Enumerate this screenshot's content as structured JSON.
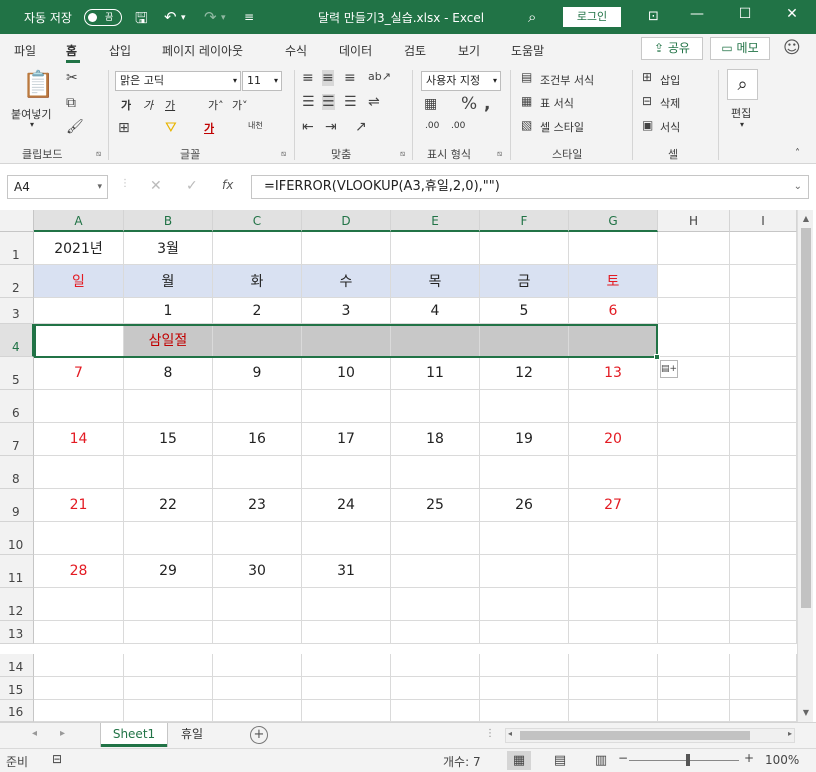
{
  "titlebar": {
    "autosave_label": "자동 저장",
    "autosave_state": "끔",
    "title": "달력 만들기3_실습.xlsx  -  Excel",
    "login": "로그인",
    "minimize": "—",
    "maximize": "☐",
    "close": "✕"
  },
  "tabs": [
    "파일",
    "홈",
    "삽입",
    "페이지 레이아웃",
    "수식",
    "데이터",
    "검토",
    "보기",
    "도움말"
  ],
  "share_label": "공유",
  "memo_label": "메모",
  "ribbon": {
    "paste": "붙여넣기",
    "clipboard": "클립보드",
    "font_name": "맑은 고딕",
    "font_size": "11",
    "font_group": "글꼴",
    "align_group": "맞춤",
    "number_format": "사용자 지정",
    "number_group": "표시 형식",
    "cond_format": "조건부 서식",
    "table_format": "표 서식",
    "cell_style": "셀 스타일",
    "style_group": "스타일",
    "insert": "삽입",
    "delete": "삭제",
    "format": "서식",
    "cells_group": "셀",
    "edit": "편집"
  },
  "formula_bar": {
    "name_box": "A4",
    "fx": "fx",
    "formula": "=IFERROR(VLOOKUP(A3,휴일,2,0),\"\")"
  },
  "columns": [
    "A",
    "B",
    "C",
    "D",
    "E",
    "F",
    "G",
    "H",
    "I"
  ],
  "rows": [
    "1",
    "2",
    "3",
    "4",
    "5",
    "6",
    "7",
    "8",
    "9",
    "10",
    "11",
    "12",
    "13",
    "14",
    "15",
    "16"
  ],
  "cells": {
    "r1": [
      "2021년",
      "3월",
      "",
      "",
      "",
      "",
      ""
    ],
    "r2": [
      "일",
      "월",
      "화",
      "수",
      "목",
      "금",
      "토"
    ],
    "r3": [
      "",
      "1",
      "2",
      "3",
      "4",
      "5",
      "6"
    ],
    "r4": [
      "",
      "삼일절",
      "",
      "",
      "",
      "",
      ""
    ],
    "r5": [
      "7",
      "8",
      "9",
      "10",
      "11",
      "12",
      "13"
    ],
    "r6": [
      "",
      "",
      "",
      "",
      "",
      "",
      ""
    ],
    "r7": [
      "14",
      "15",
      "16",
      "17",
      "18",
      "19",
      "20"
    ],
    "r8": [
      "",
      "",
      "",
      "",
      "",
      "",
      ""
    ],
    "r9": [
      "21",
      "22",
      "23",
      "24",
      "25",
      "26",
      "27"
    ],
    "r10": [
      "",
      "",
      "",
      "",
      "",
      "",
      ""
    ],
    "r11": [
      "28",
      "29",
      "30",
      "31",
      "",
      "",
      ""
    ]
  },
  "sheets": [
    "Sheet1",
    "휴일"
  ],
  "status": {
    "ready": "준비",
    "count": "개수: 7",
    "zoom": "100%"
  },
  "colors": {
    "accent": "#217346",
    "day_header_bg": "#d9e1f2",
    "weekend_red": "#e31b23",
    "highlight_gray": "#c8c8c8"
  }
}
